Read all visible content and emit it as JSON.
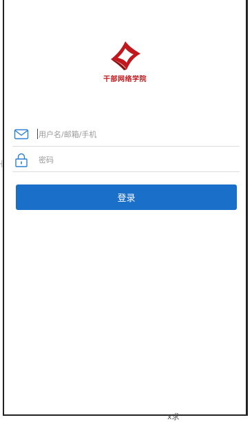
{
  "logo": {
    "text": "干部网络学院"
  },
  "form": {
    "username_placeholder": "用户名/邮箱/手机",
    "password_placeholder": "密码",
    "login_label": "登录"
  },
  "colors": {
    "brand_red": "#c0181c",
    "accent_blue": "#1a6fc9",
    "icon_blue": "#2a7fd4"
  },
  "background_fragment": {
    "text": "x求"
  }
}
